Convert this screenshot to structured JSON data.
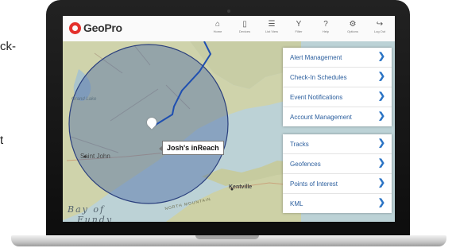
{
  "stray_text": {
    "right_top": "ck-",
    "right_mid": "t",
    "left_bottom": "-"
  },
  "app": {
    "logo": "GeoPro",
    "nav": [
      {
        "icon": "home-icon",
        "glyph": "⌂",
        "label": "Home"
      },
      {
        "icon": "devices-icon",
        "glyph": "▯",
        "label": "Devices"
      },
      {
        "icon": "list-view-icon",
        "glyph": "☰",
        "label": "List View"
      },
      {
        "icon": "filter-icon",
        "glyph": "Y",
        "label": "Filter"
      },
      {
        "icon": "help-icon",
        "glyph": "?",
        "label": "Help"
      },
      {
        "icon": "options-icon",
        "glyph": "⚙",
        "label": "Options"
      },
      {
        "icon": "logout-icon",
        "glyph": "↪",
        "label": "Log Out"
      }
    ]
  },
  "map": {
    "labels": {
      "saint_john": "Saint John",
      "kentville": "Kentville",
      "grand_lake": "Grand Lake",
      "bay1": "Bay of",
      "bay2": "Fundy",
      "north_mountain": "NORTH MOUNTAIN"
    },
    "marker_label": "Josh's inReach",
    "colors": {
      "radius": "#4c6aa6",
      "track": "#1f4fb0"
    }
  },
  "menu_1": [
    {
      "label": "Alert Management"
    },
    {
      "label": "Check-In Schedules"
    },
    {
      "label": "Event Notifications"
    },
    {
      "label": "Account Management"
    }
  ],
  "menu_2": [
    {
      "label": "Tracks"
    },
    {
      "label": "Geofences"
    },
    {
      "label": "Points of Interest"
    },
    {
      "label": "KML"
    }
  ]
}
